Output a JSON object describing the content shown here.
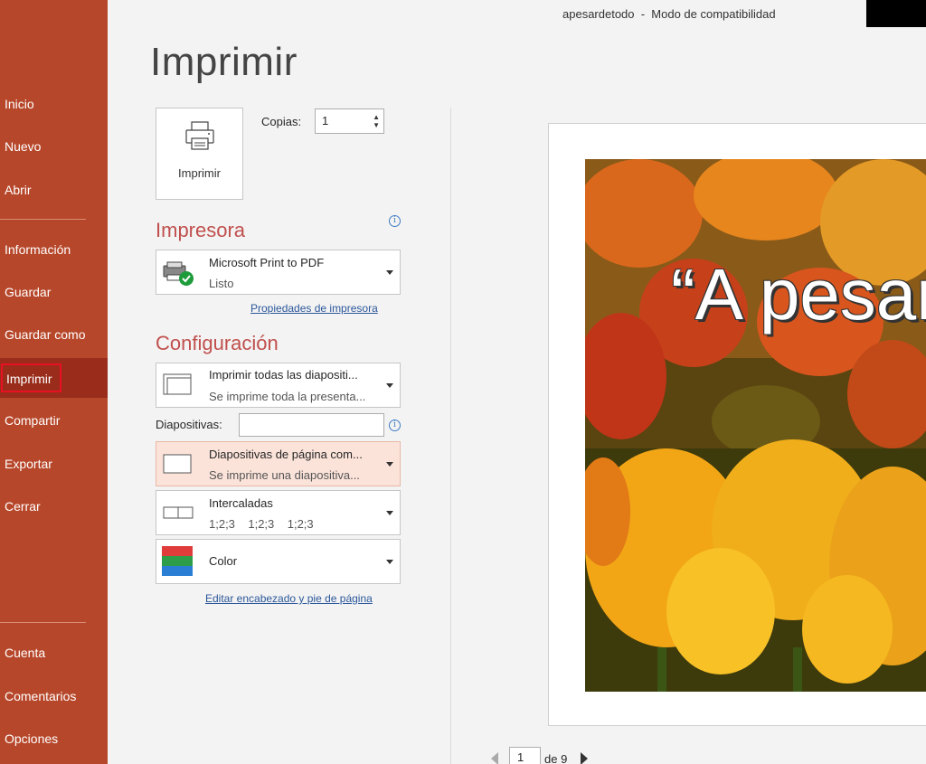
{
  "window": {
    "title": "apesardetodo  -  Modo de compatibilidad"
  },
  "sidebar": {
    "items": [
      {
        "label": "Inicio"
      },
      {
        "label": "Nuevo"
      },
      {
        "label": "Abrir"
      },
      {
        "label": "Información"
      },
      {
        "label": "Guardar"
      },
      {
        "label": "Guardar como"
      },
      {
        "label": "Imprimir",
        "active": true
      },
      {
        "label": "Compartir"
      },
      {
        "label": "Exportar"
      },
      {
        "label": "Cerrar"
      },
      {
        "label": "Cuenta"
      },
      {
        "label": "Comentarios"
      },
      {
        "label": "Opciones"
      }
    ]
  },
  "print": {
    "page_title": "Imprimir",
    "button_label": "Imprimir",
    "copies_label": "Copias:",
    "copies_value": "1"
  },
  "printer": {
    "section_title": "Impresora",
    "name": "Microsoft Print to PDF",
    "status": "Listo",
    "properties_link": "Propiedades de impresora"
  },
  "settings": {
    "section_title": "Configuración",
    "range_main": "Imprimir todas las diapositi...",
    "range_sub": "Se imprime toda la presenta...",
    "slides_label": "Diapositivas:",
    "slides_value": "",
    "layout_main": "Diapositivas de página com...",
    "layout_sub": "Se imprime una diapositiva...",
    "collate_main": "Intercaladas",
    "collate_sub": "1;2;3    1;2;3    1;2;3",
    "color_main": "Color",
    "header_footer_link": "Editar encabezado y pie de página"
  },
  "preview": {
    "slide_text": "“A pesar",
    "page_value": "1",
    "page_of": "de 9"
  },
  "colors": {
    "accent": "#b7472a",
    "active_nav": "#992c1a",
    "section_title": "#c0504d",
    "link": "#2b579a"
  }
}
